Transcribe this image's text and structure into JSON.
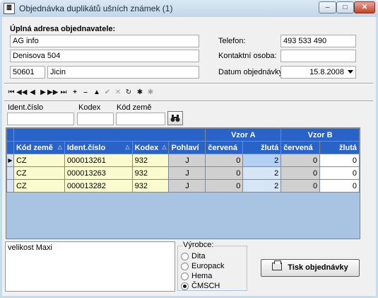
{
  "window": {
    "title": "Objednávka duplikátů ušních známek (1)",
    "minimize": "–",
    "maximize": "□",
    "close": "✕"
  },
  "address": {
    "heading": "Úplná adresa objednavatele:",
    "line1": "AG info",
    "line2": "Denisova 504",
    "zip": "50601",
    "city": "Jicin"
  },
  "contact": {
    "phone_label": "Telefon:",
    "phone_value": "493 533 490",
    "person_label": "Kontaktní osoba:",
    "person_value": "",
    "date_label": "Datum objednávky:",
    "date_value": "15.8.2008"
  },
  "navigator": {
    "buttons": [
      "⏮",
      "◀◀",
      "◀",
      "▶",
      "▶▶",
      "⏭",
      "+",
      "–",
      "▲",
      "✔",
      "✕",
      "↻",
      "✱",
      "✱"
    ]
  },
  "search": {
    "ident_label": "Ident.číslo",
    "kodex_label": "Kodex",
    "kod_zeme_label": "Kód země",
    "ident_value": "",
    "kodex_value": "",
    "kod_zeme_value": "",
    "find_icon": "binoculars-icon"
  },
  "grid": {
    "group_headers": {
      "vzor_a": "Vzor A",
      "vzor_b": "Vzor B"
    },
    "columns": [
      "Kód země",
      "Ident.číslo",
      "Kodex",
      "Pohlaví",
      "červená",
      "žlutá",
      "červená",
      "žlutá"
    ],
    "sort_glyph": "△",
    "current_row_marker": "▶",
    "rows": [
      {
        "kod_zeme": "CZ",
        "ident": "000013261",
        "kodex": "932",
        "pohlavi": "J",
        "a_cervena": "0",
        "a_zluta": "2",
        "b_cervena": "0",
        "b_zluta": "0"
      },
      {
        "kod_zeme": "CZ",
        "ident": "000013263",
        "kodex": "932",
        "pohlavi": "J",
        "a_cervena": "0",
        "a_zluta": "2",
        "b_cervena": "0",
        "b_zluta": "0"
      },
      {
        "kod_zeme": "CZ",
        "ident": "000013282",
        "kodex": "932",
        "pohlavi": "J",
        "a_cervena": "0",
        "a_zluta": "2",
        "b_cervena": "0",
        "b_zluta": "0"
      }
    ]
  },
  "note": {
    "text": "velikost Maxi"
  },
  "manufacturer": {
    "legend": "Výrobce:",
    "options": [
      "Dita",
      "Europack",
      "Hema",
      "ČMSCH"
    ],
    "selected": "ČMSCH"
  },
  "print_button": {
    "label": "Tisk objednávky"
  },
  "colors": {
    "header_blue": "#2a63c7",
    "grid_bg": "#a9c3e3",
    "yellow_cells": "#fbfbd0"
  }
}
